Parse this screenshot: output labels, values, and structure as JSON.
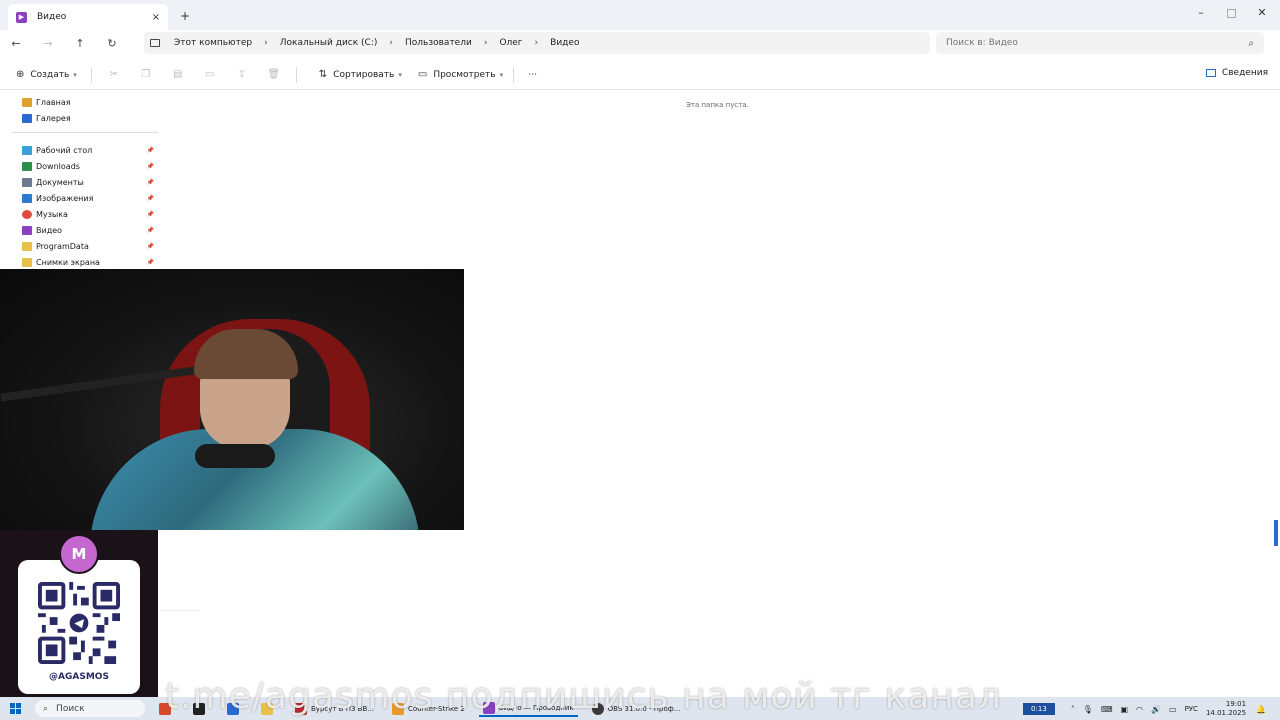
{
  "window": {
    "tab_title": "Видео",
    "new_tab_label": "+",
    "close_tab_label": "×"
  },
  "breadcrumb": [
    "Этот компьютер",
    "Локальный диск (C:)",
    "Пользователи",
    "Олег",
    "Видео"
  ],
  "search": {
    "placeholder": "Поиск в: Видео"
  },
  "toolbar": {
    "create_label": "Создать",
    "sort_label": "Сортировать",
    "view_label": "Просмотреть",
    "more_label": "⋯",
    "details_label": "Сведения"
  },
  "sidebar": {
    "top_items": [
      {
        "label": "Главная",
        "color": "#e0a030"
      },
      {
        "label": "Галерея",
        "color": "#2a6bd1"
      }
    ],
    "pinned_items": [
      {
        "label": "Рабочий стол",
        "color": "#3aa0d8"
      },
      {
        "label": "Downloads",
        "color": "#2a8f4a"
      },
      {
        "label": "Документы",
        "color": "#6a7a90"
      },
      {
        "label": "Изображения",
        "color": "#2a7bd1"
      },
      {
        "label": "Музыка",
        "color": "#e04a3a"
      },
      {
        "label": "Видео",
        "color": "#8b3fc1"
      },
      {
        "label": "ProgramData",
        "color": "#e8c04a"
      },
      {
        "label": "Снимки экрана",
        "color": "#e8c04a"
      }
    ]
  },
  "content": {
    "empty_message": "Эта папка пуста."
  },
  "qr_card": {
    "avatar_letter": "M",
    "handle": "@AGASMOS"
  },
  "overlay": {
    "text": "t.me/agasmos подпишись на мой тг канал"
  },
  "taskbar": {
    "search_label": "Поиск",
    "apps": [
      {
        "label": "",
        "color": "#d44a2a"
      },
      {
        "label": "",
        "color": "#222222"
      },
      {
        "label": "",
        "color": "#2a6bd1"
      },
      {
        "label": "",
        "color": "#2a8f4a"
      },
      {
        "label": "Бурсут В ПЗ ВВ...",
        "color": "#c0262d"
      },
      {
        "label": "Counter-Strike 2",
        "color": "#e89a2a"
      },
      {
        "label": "Видео — Проводник",
        "color": "#8b3fc1"
      },
      {
        "label": "OBS 31.0.0 - Проф...",
        "color": "#3a3a3a"
      }
    ],
    "timer": "0:13",
    "language": "РУС",
    "time": "19:01",
    "date": "14.01.2025"
  },
  "colors": {
    "accent": "#0067c0",
    "folder_yellow": "#e8c04a",
    "video_purple": "#8b3fc1"
  }
}
